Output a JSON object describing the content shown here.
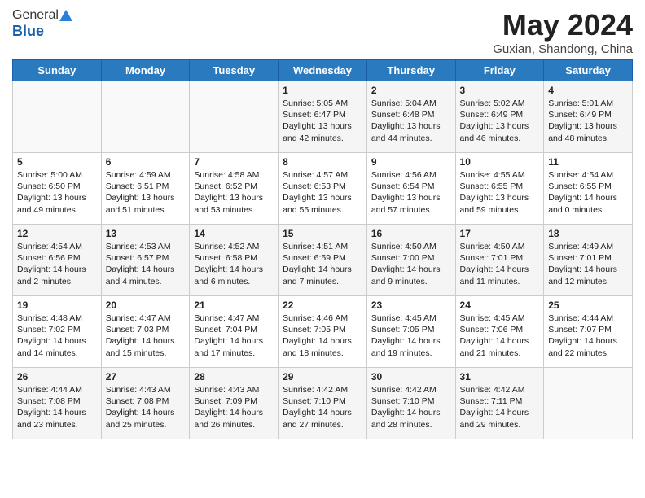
{
  "header": {
    "logo_general": "General",
    "logo_blue": "Blue",
    "month_title": "May 2024",
    "location": "Guxian, Shandong, China"
  },
  "days_of_week": [
    "Sunday",
    "Monday",
    "Tuesday",
    "Wednesday",
    "Thursday",
    "Friday",
    "Saturday"
  ],
  "weeks": [
    [
      {
        "day": "",
        "info": ""
      },
      {
        "day": "",
        "info": ""
      },
      {
        "day": "",
        "info": ""
      },
      {
        "day": "1",
        "info": "Sunrise: 5:05 AM\nSunset: 6:47 PM\nDaylight: 13 hours\nand 42 minutes."
      },
      {
        "day": "2",
        "info": "Sunrise: 5:04 AM\nSunset: 6:48 PM\nDaylight: 13 hours\nand 44 minutes."
      },
      {
        "day": "3",
        "info": "Sunrise: 5:02 AM\nSunset: 6:49 PM\nDaylight: 13 hours\nand 46 minutes."
      },
      {
        "day": "4",
        "info": "Sunrise: 5:01 AM\nSunset: 6:49 PM\nDaylight: 13 hours\nand 48 minutes."
      }
    ],
    [
      {
        "day": "5",
        "info": "Sunrise: 5:00 AM\nSunset: 6:50 PM\nDaylight: 13 hours\nand 49 minutes."
      },
      {
        "day": "6",
        "info": "Sunrise: 4:59 AM\nSunset: 6:51 PM\nDaylight: 13 hours\nand 51 minutes."
      },
      {
        "day": "7",
        "info": "Sunrise: 4:58 AM\nSunset: 6:52 PM\nDaylight: 13 hours\nand 53 minutes."
      },
      {
        "day": "8",
        "info": "Sunrise: 4:57 AM\nSunset: 6:53 PM\nDaylight: 13 hours\nand 55 minutes."
      },
      {
        "day": "9",
        "info": "Sunrise: 4:56 AM\nSunset: 6:54 PM\nDaylight: 13 hours\nand 57 minutes."
      },
      {
        "day": "10",
        "info": "Sunrise: 4:55 AM\nSunset: 6:55 PM\nDaylight: 13 hours\nand 59 minutes."
      },
      {
        "day": "11",
        "info": "Sunrise: 4:54 AM\nSunset: 6:55 PM\nDaylight: 14 hours\nand 0 minutes."
      }
    ],
    [
      {
        "day": "12",
        "info": "Sunrise: 4:54 AM\nSunset: 6:56 PM\nDaylight: 14 hours\nand 2 minutes."
      },
      {
        "day": "13",
        "info": "Sunrise: 4:53 AM\nSunset: 6:57 PM\nDaylight: 14 hours\nand 4 minutes."
      },
      {
        "day": "14",
        "info": "Sunrise: 4:52 AM\nSunset: 6:58 PM\nDaylight: 14 hours\nand 6 minutes."
      },
      {
        "day": "15",
        "info": "Sunrise: 4:51 AM\nSunset: 6:59 PM\nDaylight: 14 hours\nand 7 minutes."
      },
      {
        "day": "16",
        "info": "Sunrise: 4:50 AM\nSunset: 7:00 PM\nDaylight: 14 hours\nand 9 minutes."
      },
      {
        "day": "17",
        "info": "Sunrise: 4:50 AM\nSunset: 7:01 PM\nDaylight: 14 hours\nand 11 minutes."
      },
      {
        "day": "18",
        "info": "Sunrise: 4:49 AM\nSunset: 7:01 PM\nDaylight: 14 hours\nand 12 minutes."
      }
    ],
    [
      {
        "day": "19",
        "info": "Sunrise: 4:48 AM\nSunset: 7:02 PM\nDaylight: 14 hours\nand 14 minutes."
      },
      {
        "day": "20",
        "info": "Sunrise: 4:47 AM\nSunset: 7:03 PM\nDaylight: 14 hours\nand 15 minutes."
      },
      {
        "day": "21",
        "info": "Sunrise: 4:47 AM\nSunset: 7:04 PM\nDaylight: 14 hours\nand 17 minutes."
      },
      {
        "day": "22",
        "info": "Sunrise: 4:46 AM\nSunset: 7:05 PM\nDaylight: 14 hours\nand 18 minutes."
      },
      {
        "day": "23",
        "info": "Sunrise: 4:45 AM\nSunset: 7:05 PM\nDaylight: 14 hours\nand 19 minutes."
      },
      {
        "day": "24",
        "info": "Sunrise: 4:45 AM\nSunset: 7:06 PM\nDaylight: 14 hours\nand 21 minutes."
      },
      {
        "day": "25",
        "info": "Sunrise: 4:44 AM\nSunset: 7:07 PM\nDaylight: 14 hours\nand 22 minutes."
      }
    ],
    [
      {
        "day": "26",
        "info": "Sunrise: 4:44 AM\nSunset: 7:08 PM\nDaylight: 14 hours\nand 23 minutes."
      },
      {
        "day": "27",
        "info": "Sunrise: 4:43 AM\nSunset: 7:08 PM\nDaylight: 14 hours\nand 25 minutes."
      },
      {
        "day": "28",
        "info": "Sunrise: 4:43 AM\nSunset: 7:09 PM\nDaylight: 14 hours\nand 26 minutes."
      },
      {
        "day": "29",
        "info": "Sunrise: 4:42 AM\nSunset: 7:10 PM\nDaylight: 14 hours\nand 27 minutes."
      },
      {
        "day": "30",
        "info": "Sunrise: 4:42 AM\nSunset: 7:10 PM\nDaylight: 14 hours\nand 28 minutes."
      },
      {
        "day": "31",
        "info": "Sunrise: 4:42 AM\nSunset: 7:11 PM\nDaylight: 14 hours\nand 29 minutes."
      },
      {
        "day": "",
        "info": ""
      }
    ]
  ]
}
